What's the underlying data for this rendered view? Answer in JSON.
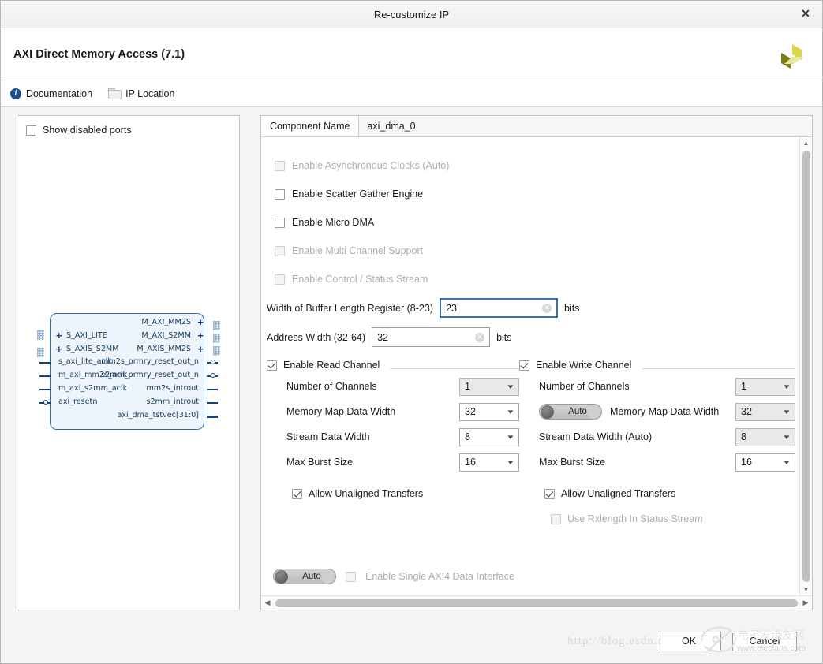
{
  "window": {
    "title": "Re-customize IP",
    "close_label": "✕"
  },
  "header": {
    "ip_title": "AXI Direct Memory Access (7.1)",
    "logo_name": "xilinx-logo"
  },
  "toolbar": {
    "documentation_label": "Documentation",
    "ip_location_label": "IP Location"
  },
  "left_panel": {
    "show_disabled_ports_label": "Show disabled ports",
    "show_disabled_ports_checked": false,
    "symbol": {
      "left_buses": [
        "S_AXI_LITE",
        "S_AXIS_S2MM"
      ],
      "right_buses": [
        "M_AXI_MM2S",
        "M_AXI_S2MM",
        "M_AXIS_MM2S"
      ],
      "left_pins": [
        "s_axi_lite_aclk",
        "m_axi_mm2s_aclk",
        "m_axi_s2mm_aclk",
        "axi_resetn"
      ],
      "right_pins": [
        "mm2s_prmry_reset_out_n",
        "s2mm_prmry_reset_out_n",
        "mm2s_introut",
        "s2mm_introut",
        "axi_dma_tstvec[31:0]"
      ]
    }
  },
  "form": {
    "component_name_label": "Component Name",
    "component_name_value": "axi_dma_0",
    "checkboxes": [
      {
        "label": "Enable Asynchronous Clocks (Auto)",
        "checked": false,
        "disabled": true
      },
      {
        "label": "Enable Scatter Gather Engine",
        "checked": false,
        "disabled": false
      },
      {
        "label": "Enable Micro DMA",
        "checked": false,
        "disabled": false
      },
      {
        "label": "Enable Multi Channel Support",
        "checked": false,
        "disabled": true
      },
      {
        "label": "Enable Control / Status Stream",
        "checked": false,
        "disabled": true
      }
    ],
    "buffer_length": {
      "label": "Width of Buffer Length Register (8-23)",
      "value": "23",
      "units": "bits"
    },
    "address_width": {
      "label": "Address Width (32-64)",
      "value": "32",
      "units": "bits"
    },
    "read_channel": {
      "header_label": "Enable Read Channel",
      "header_checked": true,
      "rows": [
        {
          "label": "Number of Channels",
          "value": "1",
          "grey": true
        },
        {
          "label": "Memory Map Data Width",
          "value": "32",
          "grey": false
        },
        {
          "label": "Stream Data Width",
          "value": "8",
          "grey": false
        },
        {
          "label": "Max Burst Size",
          "value": "16",
          "grey": false
        }
      ],
      "allow_unaligned_label": "Allow Unaligned Transfers",
      "allow_unaligned_checked": true
    },
    "write_channel": {
      "header_label": "Enable Write Channel",
      "header_checked": true,
      "rows": [
        {
          "label": "Number of Channels",
          "value": "1",
          "grey": true
        },
        {
          "label": "Memory Map Data Width",
          "value": "32",
          "grey": true,
          "toggle": "Auto"
        },
        {
          "label": "Stream Data Width (Auto)",
          "value": "8",
          "grey": true
        },
        {
          "label": "Max Burst Size",
          "value": "16",
          "grey": false
        }
      ],
      "allow_unaligned_label": "Allow Unaligned Transfers",
      "allow_unaligned_checked": true,
      "use_rxlength_label": "Use Rxlength In Status Stream",
      "use_rxlength_checked": false,
      "use_rxlength_disabled": true
    },
    "single_axi4": {
      "toggle_label": "Auto",
      "checkbox_label": "Enable Single AXI4 Data Interface",
      "checked": false,
      "disabled": true
    }
  },
  "footer": {
    "ok_label": "OK",
    "cancel_label": "Cancel"
  },
  "watermark": {
    "url": "http://blog.esdn.r",
    "site": "www.elecfans.com",
    "brand": "电子发烧友网"
  }
}
